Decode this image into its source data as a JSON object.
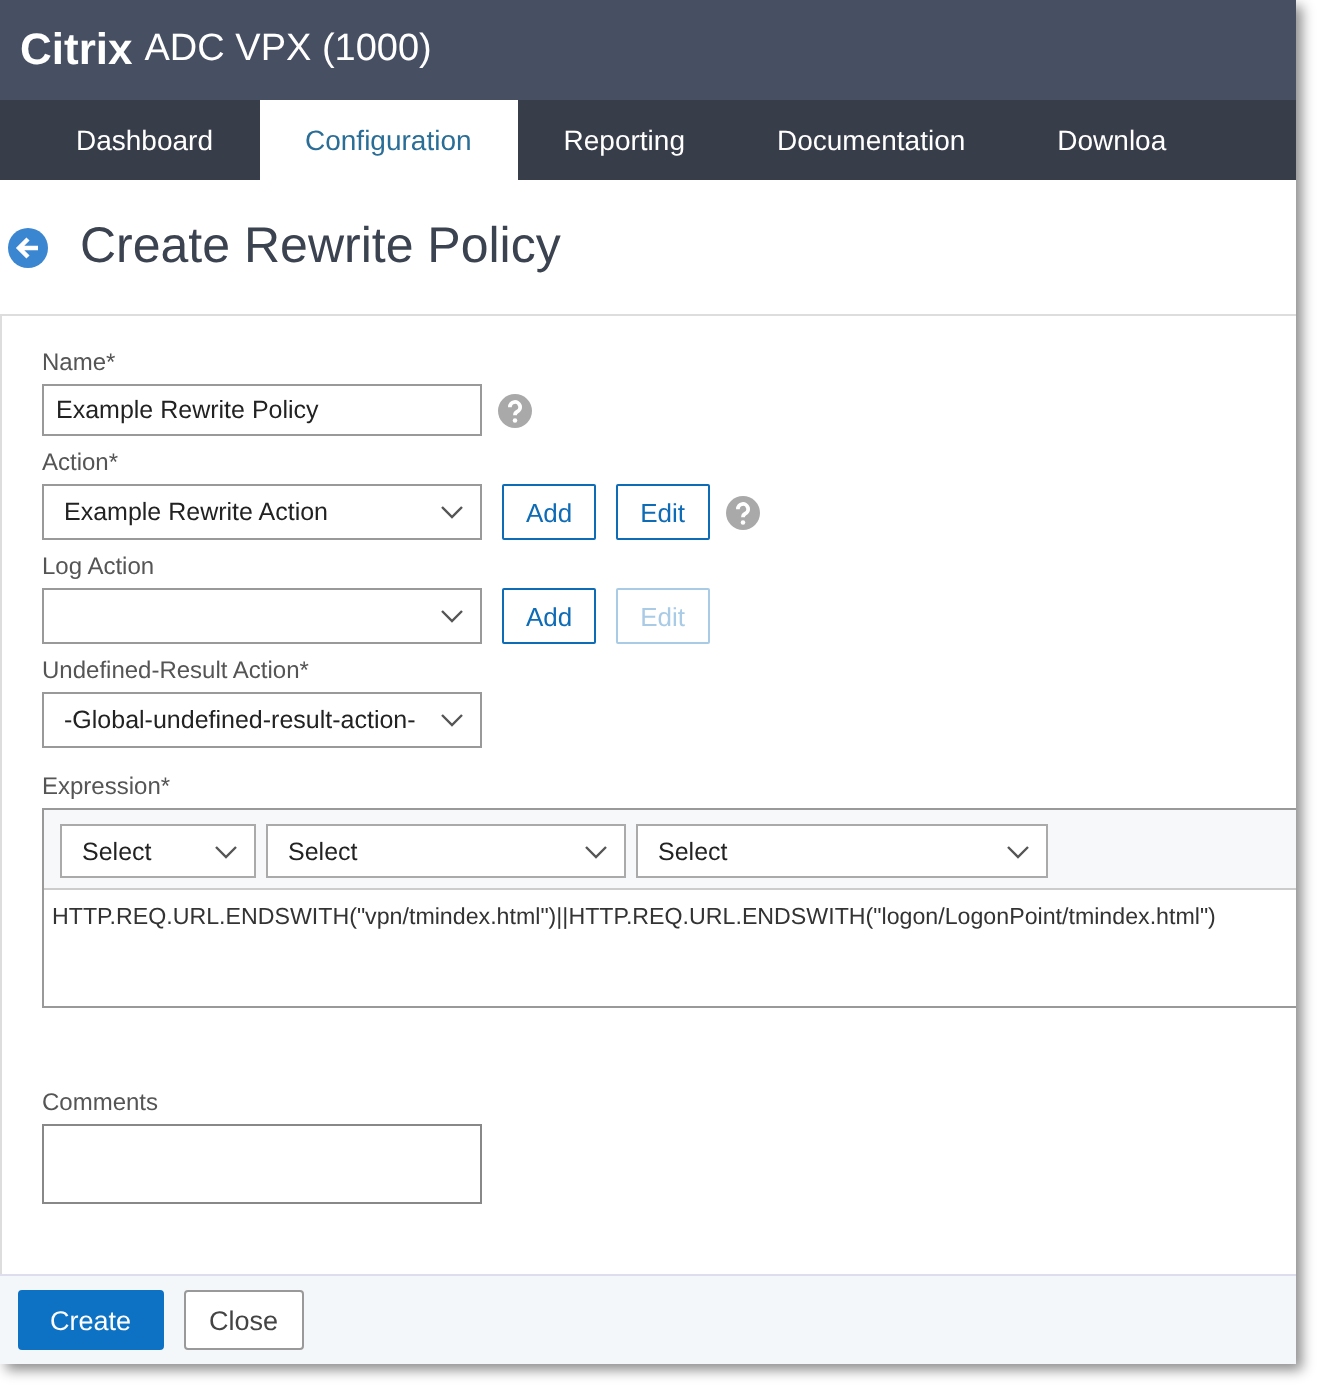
{
  "app": {
    "brand": "Citrix",
    "product": "ADC VPX (1000)"
  },
  "tabs": [
    {
      "label": "Dashboard",
      "selected": false
    },
    {
      "label": "Configuration",
      "selected": true
    },
    {
      "label": "Reporting",
      "selected": false
    },
    {
      "label": "Documentation",
      "selected": false
    },
    {
      "label": "Downloa",
      "selected": false
    }
  ],
  "page": {
    "title": "Create Rewrite Policy"
  },
  "fields": [
    {
      "kind": "text",
      "label": "Name*",
      "value": "Example Rewrite Policy",
      "help": true
    },
    {
      "kind": "select",
      "label": "Action*",
      "value": "Example Rewrite Action",
      "help": true,
      "buttons": [
        {
          "label": "Add",
          "disabled": false
        },
        {
          "label": "Edit",
          "disabled": false
        }
      ]
    },
    {
      "kind": "select",
      "label": "Log Action",
      "help": false,
      "buttons": [
        {
          "label": "Add",
          "disabled": false
        },
        {
          "label": "Edit",
          "disabled": true
        }
      ]
    },
    {
      "kind": "select",
      "label": "Undefined-Result Action*",
      "value": "-Global-undefined-result-action-",
      "help": false
    }
  ],
  "expression": {
    "label": "Expression*",
    "selects": [
      "Select",
      "Select",
      "Select"
    ],
    "value": "HTTP.REQ.URL.ENDSWITH(\"vpn/tmindex.html\")||HTTP.REQ.URL.ENDSWITH(\"logon/LogonPoint/tmindex.html\")"
  },
  "comments": {
    "label": "Comments"
  },
  "buttons": [
    {
      "label": "Create",
      "kind": "primary"
    },
    {
      "label": "Close",
      "kind": "secondary"
    }
  ]
}
